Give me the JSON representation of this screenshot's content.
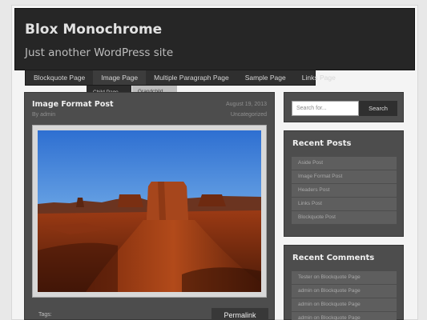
{
  "site": {
    "title": "Blox Monochrome",
    "tagline": "Just another WordPress site"
  },
  "nav": {
    "items": [
      "Blockquote Page",
      "Image Page",
      "Multiple Paragraph Page",
      "Sample Page",
      "Links Page"
    ],
    "submenu": [
      "Child Page",
      "Grandchild Page"
    ]
  },
  "post": {
    "title": "Image Format Post",
    "author": "By admin",
    "date": "August 19, 2013",
    "category": "Uncategorized",
    "image_alt": "Desert mesa landscape",
    "tags_label": "Tags:",
    "permalink": "Permalink"
  },
  "search": {
    "placeholder": "Search for...",
    "button": "Search"
  },
  "recent_posts": {
    "title": "Recent Posts",
    "items": [
      "Aside Post",
      "Image Format Post",
      "Headers Post",
      "Links Post",
      "Blockquote Post"
    ]
  },
  "recent_comments": {
    "title": "Recent Comments",
    "items": [
      "Tester on Blockquote Page",
      "admin on Blockquote Page",
      "admin on Blockquote Page",
      "admin on Blockquote Page"
    ]
  },
  "colors": {
    "header_bg": "#262626",
    "panel_bg": "#4d4d4d",
    "page_bg": "#f4f4f4"
  }
}
